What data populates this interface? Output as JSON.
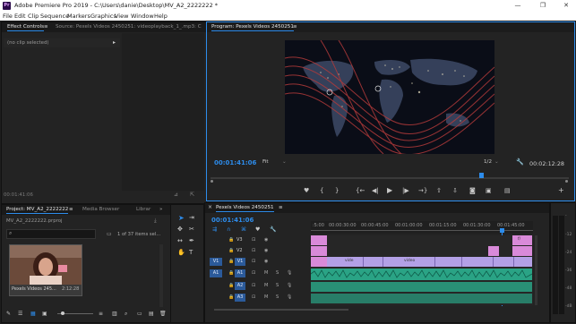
{
  "window": {
    "title": "Adobe Premiere Pro 2019 - C:\\Users\\danie\\Desktop\\MV_A2_2222222 *",
    "app_icon": "Pr",
    "minimize": "—",
    "maximize": "❐",
    "close": "✕"
  },
  "menu": [
    "File",
    "Edit",
    "Clip",
    "Sequence",
    "Markers",
    "Graphics",
    "View",
    "Window",
    "Help"
  ],
  "effect_controls": {
    "tab": "Effect Controls",
    "tab_menu": "≡",
    "source_tab": "Source: Pexels Videos 2450251: videoplayback_1_.mp3: C",
    "no_clip": "(no clip selected)",
    "timecode": "00:01:41:06"
  },
  "program": {
    "tab": "Program: Pexels Videos 2450251",
    "tab_menu": "≡",
    "timecode": "00:01:41:06",
    "fit": "Fit",
    "resolution": "1/2",
    "duration": "00:02:12:28"
  },
  "project": {
    "tab": "Project: MV_A2_2222222",
    "tab_menu": "≡",
    "media_browser_tab": "Media Browser",
    "library_tab": "Librar",
    "more": "»",
    "file": "MV_A2_2222222.prproj",
    "items_count": "1 of 37 items sel...",
    "thumb_name": "Pexels Videos 245...",
    "thumb_duration": "2:12:28"
  },
  "timeline": {
    "tab": "Pexels Videos 2450251",
    "tab_menu": "≡",
    "timecode": "00:01:41:06",
    "ruler": [
      ":5:00",
      "00:00:30:00",
      "00:00:45:00",
      "00:01:00:00",
      "00:01:15:00",
      "00:01:30:00",
      "00:01:45:00"
    ],
    "tracks": [
      {
        "name": "V3",
        "src": ""
      },
      {
        "name": "V2",
        "src": ""
      },
      {
        "name": "V1",
        "src": "V1"
      },
      {
        "name": "A1",
        "src": "A1"
      },
      {
        "name": "A2",
        "src": "A2"
      },
      {
        "name": "A3",
        "src": "A3"
      }
    ],
    "clip_labels": [
      "vide",
      "video",
      "f/"
    ]
  },
  "audio_meter": {
    "scale": [
      "-",
      "-12",
      "-24",
      "-36",
      "-48",
      "-dB"
    ],
    "solo": "S",
    "solo2": "S"
  },
  "colors": {
    "accent": "#2d8ceb",
    "clip_pink": "#d98ad9",
    "clip_lavender": "#b3a0e6",
    "clip_audio": "#2aa385",
    "panel_bg": "#232323",
    "app_bg": "#1d1d1d"
  }
}
